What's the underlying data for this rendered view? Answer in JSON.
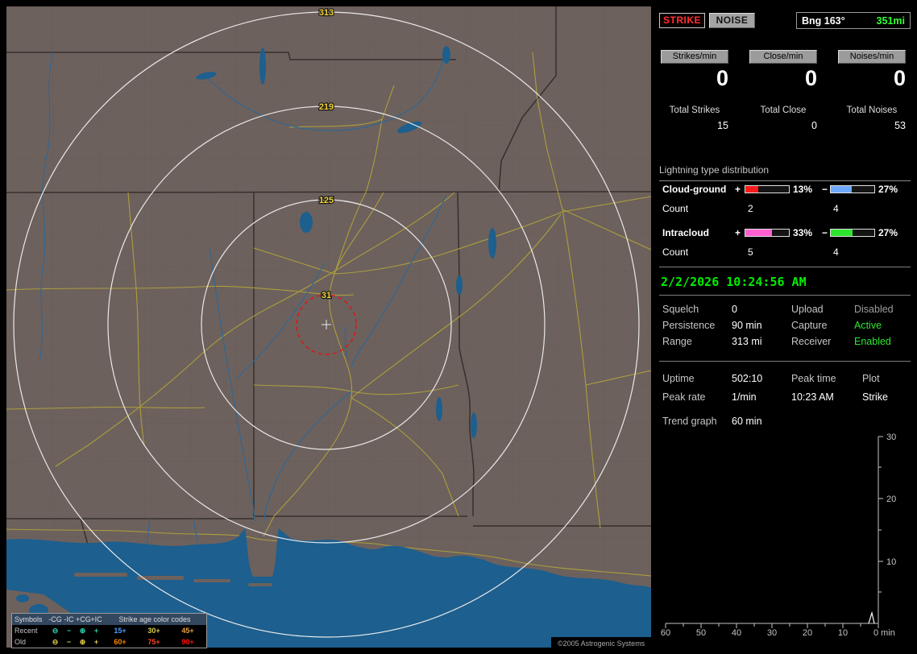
{
  "map": {
    "ring_labels": [
      "313",
      "219",
      "125",
      "31"
    ],
    "copyright": "©2005 Astrogenic Systems",
    "legend": {
      "header_label": "Symbols",
      "symbol_columns": [
        "-CG",
        "-IC",
        "+CG",
        "+IC"
      ],
      "age_header": "Strike age color codes",
      "symbols": [
        "⊖",
        "−",
        "⊕",
        "+"
      ],
      "rows": [
        {
          "label": "Recent",
          "symbol_color": "#2fd3b0",
          "ages": [
            {
              "text": "15+",
              "color": "#4f9bff"
            },
            {
              "text": "30+",
              "color": "#d6d14a"
            },
            {
              "text": "45+",
              "color": "#e8a03c"
            }
          ]
        },
        {
          "label": "Old",
          "symbol_color": "#e0d04a",
          "ages": [
            {
              "text": "60+",
              "color": "#ff8800"
            },
            {
              "text": "75+",
              "color": "#ff4422"
            },
            {
              "text": "90+",
              "color": "#ff0f0f"
            }
          ]
        }
      ]
    }
  },
  "sidebar": {
    "mode_buttons": {
      "strike": "STRIKE",
      "noise": "NOISE"
    },
    "bearing": {
      "label": "Bng 163°",
      "range": "351mi",
      "range_color": "#33ff33"
    },
    "rates": [
      {
        "label": "Strikes/min",
        "value": "0",
        "total_label": "Total Strikes",
        "total_value": "15"
      },
      {
        "label": "Close/min",
        "value": "0",
        "total_label": "Total Close",
        "total_value": "0"
      },
      {
        "label": "Noises/min",
        "value": "0",
        "total_label": "Total Noises",
        "total_value": "53"
      }
    ],
    "distribution": {
      "title": "Lightning type distribution",
      "count_label": "Count",
      "plus_sign": "+",
      "minus_sign": "−",
      "rows": [
        {
          "name": "Cloud-ground",
          "plus_pct": "13%",
          "minus_pct": "27%",
          "plus_count": "2",
          "minus_count": "4",
          "plus_color": "#ff1a1a",
          "minus_color": "#6fa8ff",
          "plus_fill": 30,
          "minus_fill": 48
        },
        {
          "name": "Intracloud",
          "plus_pct": "33%",
          "minus_pct": "27%",
          "plus_count": "5",
          "minus_count": "4",
          "plus_color": "#ff5fd0",
          "minus_color": "#2ee62e",
          "plus_fill": 62,
          "minus_fill": 50
        }
      ]
    },
    "clock": "2/2/2026 10:24:56 AM",
    "settings": {
      "rows": [
        {
          "l1": "Squelch",
          "v1": "0",
          "l2": "Upload",
          "v2": "Disabled",
          "v2_color": "#9e9e9e"
        },
        {
          "l1": "Persistence",
          "v1": "90 min",
          "l2": "Capture",
          "v2": "Active",
          "v2_color": "#2ee62e"
        },
        {
          "l1": "Range",
          "v1": "313 mi",
          "l2": "Receiver",
          "v2": "Enabled",
          "v2_color": "#2ee62e"
        }
      ]
    },
    "stats": {
      "uptime_label": "Uptime",
      "uptime": "502:10",
      "peak_time_label": "Peak time",
      "peak_time": "10:23 AM",
      "plot_label": "Plot",
      "plot_value": "Strike",
      "peak_rate_label": "Peak rate",
      "peak_rate": "1/min",
      "trend_label": "Trend graph",
      "trend_window": "60 min"
    }
  },
  "chart_data": {
    "type": "line",
    "title": "Trend graph",
    "window": "60 min",
    "x_tick_labels": [
      "60",
      "50",
      "40",
      "30",
      "20",
      "10"
    ],
    "origin_label": "0 min",
    "y_tick_labels": [
      "30",
      "20",
      "10"
    ],
    "x_range_minutes_ago": [
      60,
      0
    ],
    "y_range": [
      0,
      30
    ],
    "series": [
      {
        "name": "Strikes/min",
        "nonzero_points": [
          {
            "minutes_ago": 1,
            "value": 1
          }
        ],
        "all_other_values": 0
      }
    ]
  }
}
